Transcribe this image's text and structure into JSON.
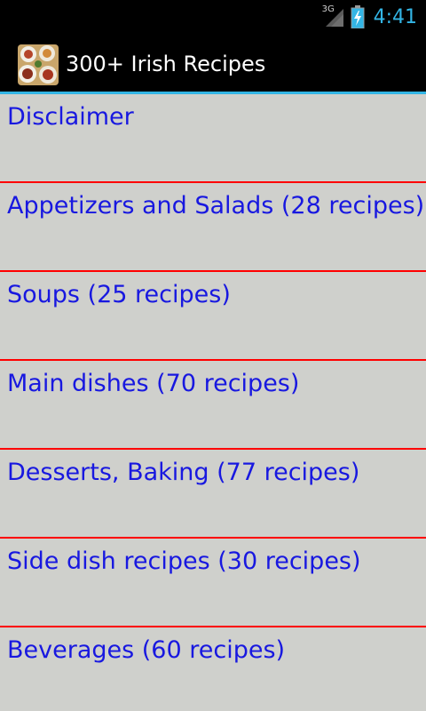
{
  "status_bar": {
    "network_label": "3G",
    "time": "4:41",
    "icons": [
      "signal-icon",
      "battery-charging-icon"
    ],
    "accent_color": "#33b5e5"
  },
  "action_bar": {
    "title": "300+ Irish Recipes",
    "icon": "app-food-icon",
    "divider_color": "#33b5e5"
  },
  "list": {
    "background_color": "#cfd0cc",
    "text_color": "#1818e0",
    "divider_color": "#ff0000",
    "items": [
      {
        "label": "Disclaimer"
      },
      {
        "label": "Appetizers and Salads (28 recipes)"
      },
      {
        "label": "Soups (25 recipes)"
      },
      {
        "label": "Main dishes (70 recipes)"
      },
      {
        "label": "Desserts, Baking (77 recipes)"
      },
      {
        "label": "Side dish recipes (30 recipes)"
      },
      {
        "label": "Beverages (60 recipes)"
      }
    ]
  }
}
